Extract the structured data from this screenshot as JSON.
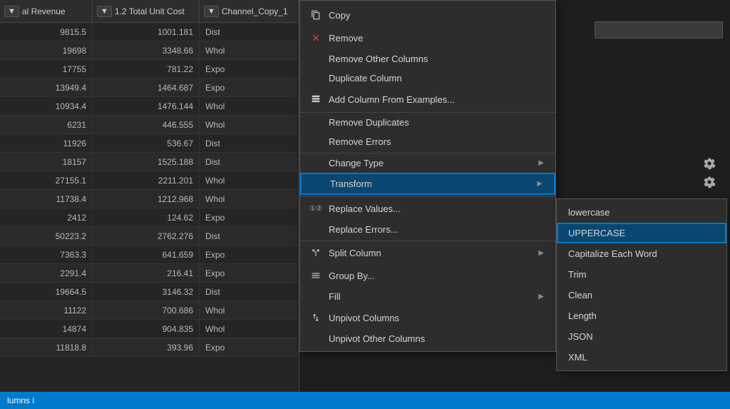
{
  "columns": [
    {
      "label": "al Revenue",
      "icon": "▼"
    },
    {
      "label": "1.2 Total Unit Cost",
      "icon": "▼"
    },
    {
      "label": "Channel_Copy_1",
      "icon": "▼"
    }
  ],
  "rows": [
    {
      "col1": "9815.5",
      "col2": "1001.181",
      "col3": "Dist"
    },
    {
      "col1": "19698",
      "col2": "3348.66",
      "col3": "Whol"
    },
    {
      "col1": "17755",
      "col2": "781.22",
      "col3": "Expo"
    },
    {
      "col1": "13949.4",
      "col2": "1464.687",
      "col3": "Expo"
    },
    {
      "col1": "10934.4",
      "col2": "1476.144",
      "col3": "Whol"
    },
    {
      "col1": "6231",
      "col2": "446.555",
      "col3": "Whol"
    },
    {
      "col1": "11926",
      "col2": "536.67",
      "col3": "Dist"
    },
    {
      "col1": "18157",
      "col2": "1525.188",
      "col3": "Dist"
    },
    {
      "col1": "27155.1",
      "col2": "2211.201",
      "col3": "Whol"
    },
    {
      "col1": "11738.4",
      "col2": "1212.968",
      "col3": "Whol"
    },
    {
      "col1": "2412",
      "col2": "124.62",
      "col3": "Expo"
    },
    {
      "col1": "50223.2",
      "col2": "2762.276",
      "col3": "Dist"
    },
    {
      "col1": "7363.3",
      "col2": "641.659",
      "col3": "Expo"
    },
    {
      "col1": "2291.4",
      "col2": "216.41",
      "col3": "Expo"
    },
    {
      "col1": "19664.5",
      "col2": "3146.32",
      "col3": "Dist"
    },
    {
      "col1": "11122",
      "col2": "700.686",
      "col3": "Whol"
    },
    {
      "col1": "14874",
      "col2": "904.835",
      "col3": "Whol"
    },
    {
      "col1": "11818.8",
      "col2": "393.96",
      "col3": "Expo"
    }
  ],
  "contextMenu": {
    "items": [
      {
        "id": "copy",
        "label": "Copy",
        "icon": "copy",
        "hasArrow": false
      },
      {
        "id": "remove",
        "label": "Remove",
        "icon": "remove",
        "hasArrow": false
      },
      {
        "id": "remove-other-cols",
        "label": "Remove Other Columns",
        "icon": "",
        "hasArrow": false
      },
      {
        "id": "duplicate-col",
        "label": "Duplicate Column",
        "icon": "",
        "hasArrow": false
      },
      {
        "id": "add-col-examples",
        "label": "Add Column From Examples...",
        "icon": "add-col",
        "hasArrow": false
      },
      {
        "id": "remove-duplicates",
        "label": "Remove Duplicates",
        "icon": "",
        "hasArrow": false
      },
      {
        "id": "remove-errors",
        "label": "Remove Errors",
        "icon": "",
        "hasArrow": false
      },
      {
        "id": "change-type",
        "label": "Change Type",
        "icon": "",
        "hasArrow": true
      },
      {
        "id": "transform",
        "label": "Transform",
        "icon": "",
        "hasArrow": true,
        "highlighted": true
      },
      {
        "id": "replace-values",
        "label": "Replace Values...",
        "icon": "replace",
        "hasArrow": false
      },
      {
        "id": "replace-errors",
        "label": "Replace Errors...",
        "icon": "",
        "hasArrow": false
      },
      {
        "id": "split-column",
        "label": "Split Column",
        "icon": "split",
        "hasArrow": true
      },
      {
        "id": "group-by",
        "label": "Group By...",
        "icon": "group",
        "hasArrow": false
      },
      {
        "id": "fill",
        "label": "Fill",
        "icon": "",
        "hasArrow": true
      },
      {
        "id": "unpivot-columns",
        "label": "Unpivot Columns",
        "icon": "unpivot",
        "hasArrow": false
      },
      {
        "id": "unpivot-other-columns",
        "label": "Unpivot Other Columns",
        "icon": "",
        "hasArrow": false
      }
    ]
  },
  "submenu": {
    "items": [
      {
        "id": "lowercase",
        "label": "lowercase",
        "active": false
      },
      {
        "id": "uppercase",
        "label": "UPPERCASE",
        "active": true
      },
      {
        "id": "capitalize",
        "label": "Capitalize Each Word",
        "active": false
      },
      {
        "id": "trim",
        "label": "Trim",
        "active": false
      },
      {
        "id": "clean",
        "label": "Clean",
        "active": false
      },
      {
        "id": "length",
        "label": "Length",
        "active": false
      },
      {
        "id": "json",
        "label": "JSON",
        "active": false
      },
      {
        "id": "xml",
        "label": "XML",
        "active": false
      }
    ]
  },
  "statusBar": {
    "label": "lumns i"
  }
}
